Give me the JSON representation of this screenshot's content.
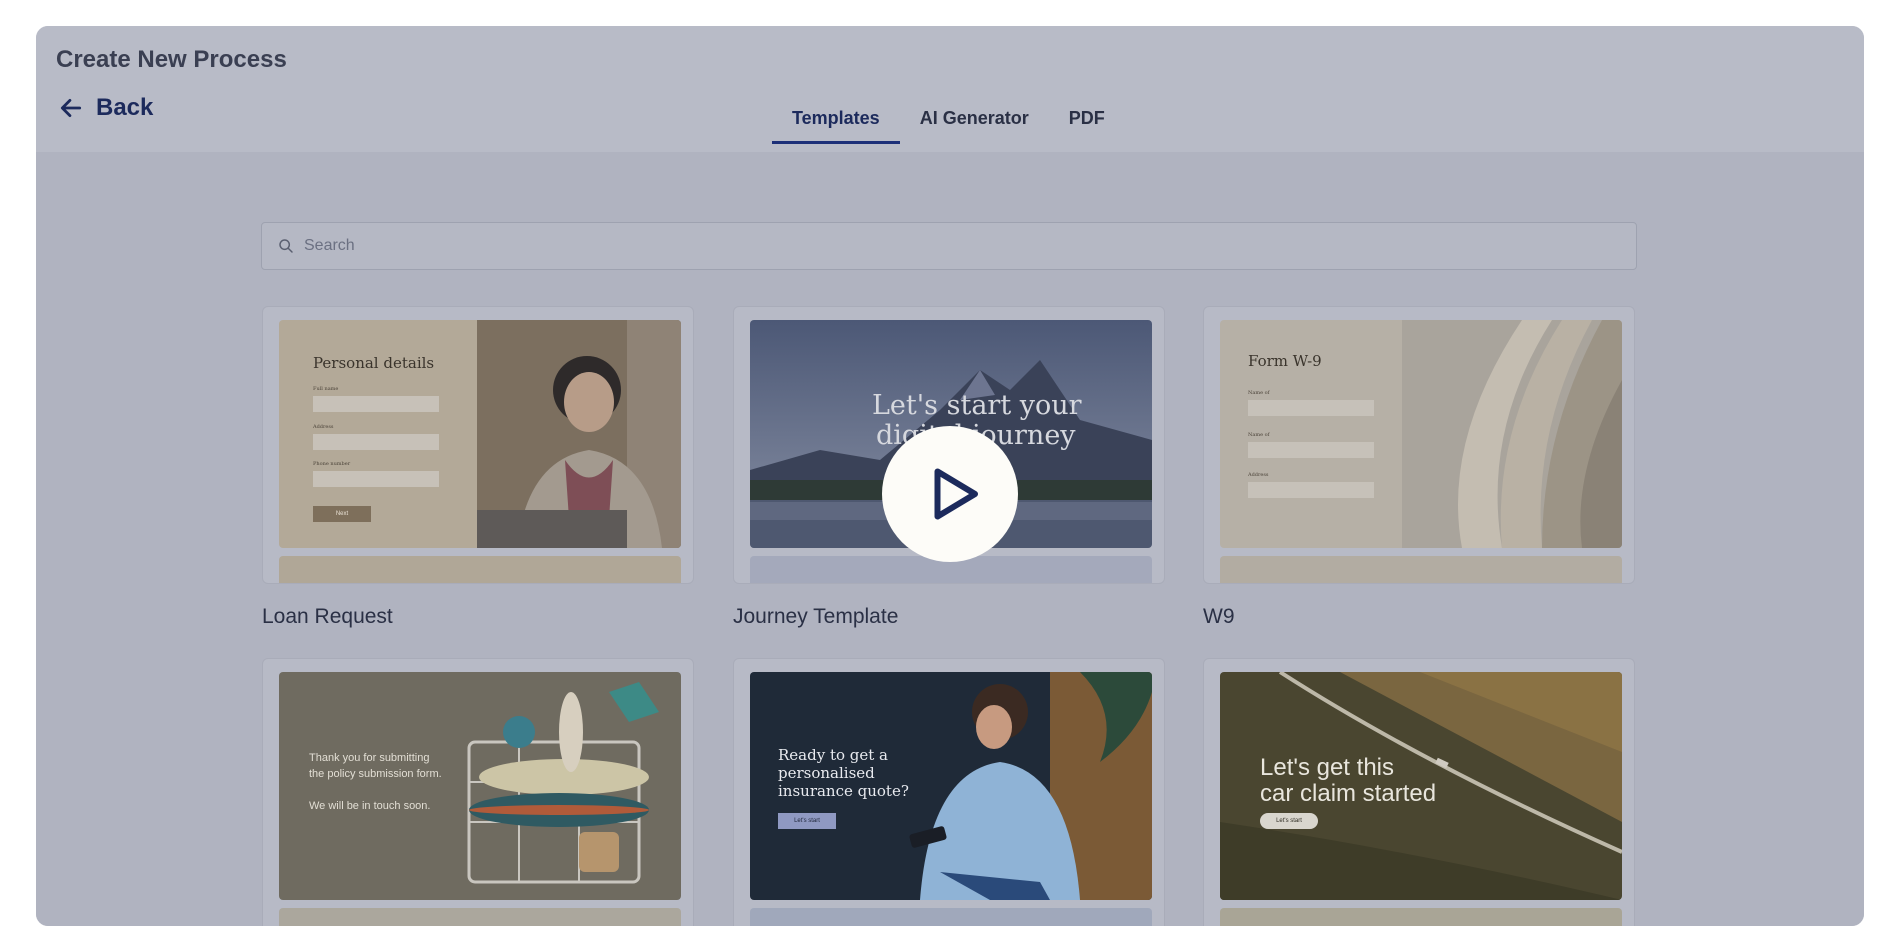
{
  "header": {
    "title": "Create New Process",
    "back_label": "Back"
  },
  "tabs": [
    {
      "label": "Templates",
      "active": true
    },
    {
      "label": "AI Generator",
      "active": false
    },
    {
      "label": "PDF",
      "active": false
    }
  ],
  "search": {
    "placeholder": "Search",
    "value": ""
  },
  "templates": [
    {
      "name": "Loan Request",
      "preview": {
        "heading": "Personal details",
        "fields": [
          "Full name",
          "Address",
          "Phone number"
        ],
        "button": "Next"
      }
    },
    {
      "name": "Journey Template",
      "preview": {
        "heading_line1": "Let's start your",
        "heading_line2": "digital journey"
      }
    },
    {
      "name": "W9",
      "preview": {
        "heading": "Form W-9",
        "fields": [
          "Name of",
          "Name of",
          "Address"
        ]
      }
    },
    {
      "name": "",
      "preview": {
        "line1": "Thank you for submitting",
        "line2": "the policy submission form.",
        "line3": "We will be in touch soon."
      }
    },
    {
      "name": "",
      "preview": {
        "line1": "Ready to get a",
        "line2": "personalised",
        "line3": "insurance quote?",
        "button": "Let's start"
      }
    },
    {
      "name": "",
      "preview": {
        "line1": "Let's get this",
        "line2": "car claim started",
        "button": "Let's start"
      }
    }
  ],
  "colors": {
    "accent": "#1c2f78",
    "overlay": "#b6b9c5"
  },
  "icons": {
    "back": "arrow-left-icon",
    "search": "search-icon",
    "play": "play-icon"
  }
}
